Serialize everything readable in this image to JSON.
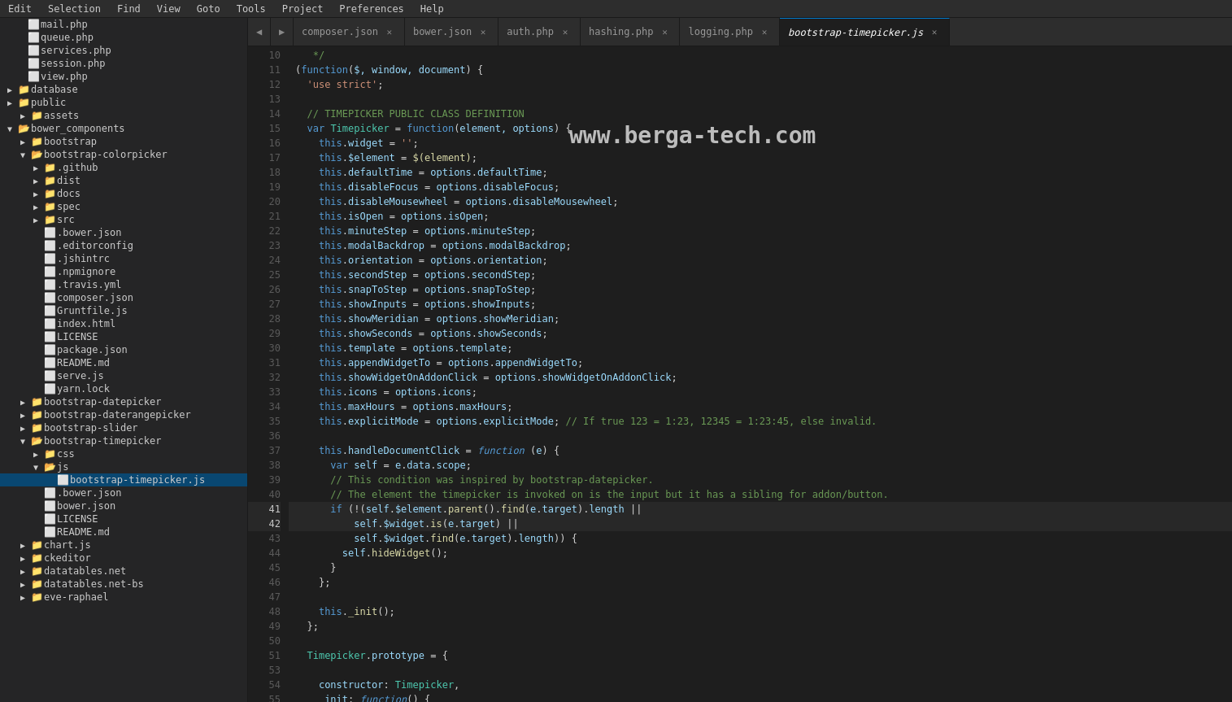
{
  "menubar": {
    "items": [
      "Edit",
      "Selection",
      "Find",
      "View",
      "Goto",
      "Tools",
      "Project",
      "Preferences",
      "Help"
    ]
  },
  "tabs": [
    {
      "label": "composer.json",
      "active": false
    },
    {
      "label": "bower.json",
      "active": false
    },
    {
      "label": "auth.php",
      "active": false
    },
    {
      "label": "hashing.php",
      "active": false
    },
    {
      "label": "logging.php",
      "active": false
    },
    {
      "label": "bootstrap-timepicker.js",
      "active": true
    }
  ],
  "watermark": "www.berga-tech.com",
  "sidebar": {
    "items": [
      {
        "indent": 0,
        "type": "file",
        "label": "mail.php",
        "ext": "php"
      },
      {
        "indent": 0,
        "type": "file",
        "label": "queue.php",
        "ext": "php"
      },
      {
        "indent": 0,
        "type": "file",
        "label": "services.php",
        "ext": "php"
      },
      {
        "indent": 0,
        "type": "file",
        "label": "session.php",
        "ext": "php"
      },
      {
        "indent": 0,
        "type": "file",
        "label": "view.php",
        "ext": "php"
      },
      {
        "indent": 0,
        "type": "folder",
        "label": "database",
        "open": false
      },
      {
        "indent": 0,
        "type": "folder",
        "label": "public",
        "open": false
      },
      {
        "indent": 0,
        "type": "folder",
        "label": "assets",
        "open": false,
        "indent_level": 1
      },
      {
        "indent": 0,
        "type": "folder",
        "label": "bower_components",
        "open": true,
        "indent_level": 0
      },
      {
        "indent": 1,
        "type": "folder",
        "label": "bootstrap",
        "open": false
      },
      {
        "indent": 1,
        "type": "folder",
        "label": "bootstrap-colorpicker",
        "open": true
      },
      {
        "indent": 2,
        "type": "folder",
        "label": ".github",
        "open": false
      },
      {
        "indent": 2,
        "type": "folder",
        "label": "dist",
        "open": false
      },
      {
        "indent": 2,
        "type": "folder",
        "label": "docs",
        "open": false
      },
      {
        "indent": 2,
        "type": "folder",
        "label": "spec",
        "open": false
      },
      {
        "indent": 2,
        "type": "folder",
        "label": "src",
        "open": false
      },
      {
        "indent": 2,
        "type": "file",
        "label": ".bower.json",
        "ext": "dot"
      },
      {
        "indent": 2,
        "type": "file",
        "label": ".editorconfig",
        "ext": "dot"
      },
      {
        "indent": 2,
        "type": "file",
        "label": ".jshintrc",
        "ext": "dot"
      },
      {
        "indent": 2,
        "type": "file",
        "label": ".npmignore",
        "ext": "dot"
      },
      {
        "indent": 2,
        "type": "file",
        "label": ".travis.yml",
        "ext": "yaml"
      },
      {
        "indent": 2,
        "type": "file",
        "label": "composer.json",
        "ext": "json"
      },
      {
        "indent": 2,
        "type": "file",
        "label": "Gruntfile.js",
        "ext": "js"
      },
      {
        "indent": 2,
        "type": "file",
        "label": "index.html",
        "ext": "html"
      },
      {
        "indent": 2,
        "type": "file",
        "label": "LICENSE",
        "ext": "license"
      },
      {
        "indent": 2,
        "type": "file",
        "label": "package.json",
        "ext": "json"
      },
      {
        "indent": 2,
        "type": "file",
        "label": "README.md",
        "ext": "md"
      },
      {
        "indent": 2,
        "type": "file",
        "label": "serve.js",
        "ext": "js"
      },
      {
        "indent": 2,
        "type": "file",
        "label": "yarn.lock",
        "ext": "dot"
      },
      {
        "indent": 1,
        "type": "folder",
        "label": "bootstrap-datepicker",
        "open": false
      },
      {
        "indent": 1,
        "type": "folder",
        "label": "bootstrap-daterangepicker",
        "open": false
      },
      {
        "indent": 1,
        "type": "folder",
        "label": "bootstrap-slider",
        "open": false
      },
      {
        "indent": 1,
        "type": "folder",
        "label": "bootstrap-timepicker",
        "open": true
      },
      {
        "indent": 2,
        "type": "folder",
        "label": "css",
        "open": false
      },
      {
        "indent": 2,
        "type": "folder",
        "label": "js",
        "open": true
      },
      {
        "indent": 3,
        "type": "file",
        "label": "bootstrap-timepicker.js",
        "ext": "js",
        "active": true
      },
      {
        "indent": 2,
        "type": "file",
        "label": ".bower.json",
        "ext": "dot"
      },
      {
        "indent": 2,
        "type": "file",
        "label": "bower.json",
        "ext": "json"
      },
      {
        "indent": 2,
        "type": "file",
        "label": "LICENSE",
        "ext": "license"
      },
      {
        "indent": 2,
        "type": "file",
        "label": "README.md",
        "ext": "md"
      },
      {
        "indent": 1,
        "type": "folder",
        "label": "chart.js",
        "open": false
      },
      {
        "indent": 1,
        "type": "folder",
        "label": "ckeditor",
        "open": false
      },
      {
        "indent": 1,
        "type": "folder",
        "label": "datatables.net",
        "open": false
      },
      {
        "indent": 1,
        "type": "folder",
        "label": "datatables.net-bs",
        "open": false
      },
      {
        "indent": 1,
        "type": "folder",
        "label": "eve-raphael",
        "open": false
      }
    ]
  }
}
